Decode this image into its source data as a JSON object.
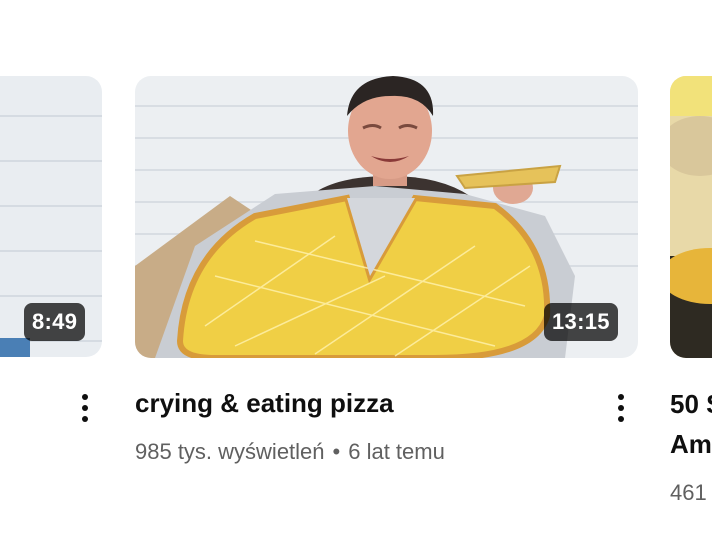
{
  "videos": [
    {
      "duration": "8:49"
    },
    {
      "duration": "13:15",
      "title": "crying & eating pizza",
      "views": "985 tys. wyświetleń",
      "separator": "•",
      "age": "6 lat temu"
    },
    {
      "title_line1": "50 S",
      "title_line2": "Am",
      "views": "461"
    }
  ],
  "colors": {
    "background": "#ffffff",
    "title": "#0f0f0f",
    "meta": "#606060",
    "duration_badge": "rgba(0,0,0,0.72)"
  },
  "icons": [
    "more-vert-icon"
  ]
}
